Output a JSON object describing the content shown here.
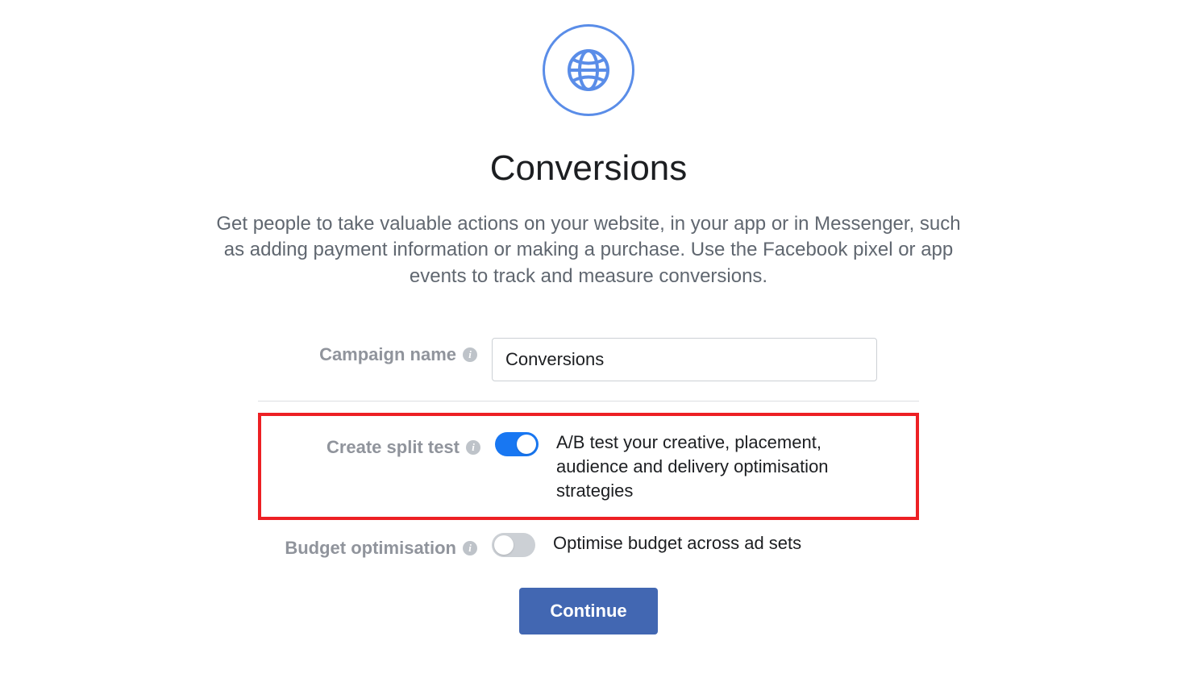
{
  "header": {
    "icon": "globe-icon",
    "title": "Conversions",
    "description": "Get people to take valuable actions on your website, in your app or in Messenger, such as adding payment information or making a purchase. Use the Facebook pixel or app events to track and measure conversions."
  },
  "form": {
    "campaign_name": {
      "label": "Campaign name",
      "value": "Conversions"
    },
    "split_test": {
      "label": "Create split test",
      "enabled": true,
      "description": "A/B test your creative, placement, audience and delivery optimisation strategies"
    },
    "budget_optimisation": {
      "label": "Budget optimisation",
      "enabled": false,
      "description": "Optimise budget across ad sets"
    }
  },
  "actions": {
    "continue_label": "Continue"
  },
  "colors": {
    "primary": "#1877f2",
    "button": "#4267b2",
    "highlight_border": "#ed2024"
  }
}
